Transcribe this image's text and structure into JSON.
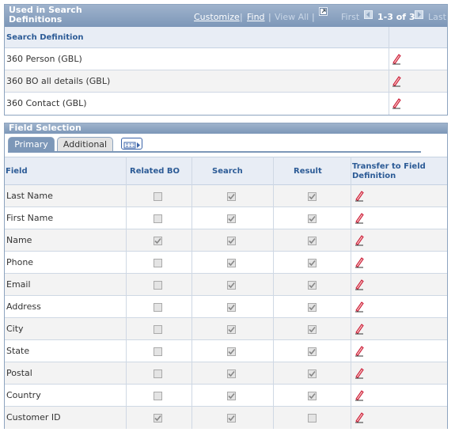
{
  "search_definitions_panel": {
    "title": "Used in Search Definitions",
    "nav": {
      "customize": "Customize",
      "find": "Find",
      "view_all": "View All",
      "first": "First",
      "range": "1-3 of 3",
      "last": "Last"
    },
    "column_header": "Search Definition",
    "rows": [
      "360 Person (GBL)",
      "360 BO all details (GBL)",
      "360 Contact (GBL)"
    ]
  },
  "field_selection_panel": {
    "title": "Field Selection",
    "tabs": [
      "Primary",
      "Additional"
    ],
    "headers": {
      "field": "Field",
      "related_bo": "Related BO",
      "search": "Search",
      "result": "Result",
      "transfer_line1": "Transfer to Field",
      "transfer_line2": "Definition"
    },
    "rows": [
      {
        "field": "Last Name",
        "related_bo": false,
        "search": true,
        "result": true
      },
      {
        "field": "First Name",
        "related_bo": false,
        "search": true,
        "result": true
      },
      {
        "field": "Name",
        "related_bo": true,
        "search": true,
        "result": true
      },
      {
        "field": "Phone",
        "related_bo": false,
        "search": true,
        "result": true
      },
      {
        "field": "Email",
        "related_bo": false,
        "search": true,
        "result": true
      },
      {
        "field": "Address",
        "related_bo": false,
        "search": true,
        "result": true
      },
      {
        "field": "City",
        "related_bo": false,
        "search": true,
        "result": true
      },
      {
        "field": "State",
        "related_bo": false,
        "search": true,
        "result": true
      },
      {
        "field": "Postal",
        "related_bo": false,
        "search": true,
        "result": true
      },
      {
        "field": "Country",
        "related_bo": false,
        "search": true,
        "result": true
      },
      {
        "field": "Customer ID",
        "related_bo": true,
        "search": true,
        "result": false
      }
    ]
  },
  "colors": {
    "header_bar": "#7c97b8",
    "header_text": "#2c5b96",
    "pencil": "#c8102e"
  }
}
